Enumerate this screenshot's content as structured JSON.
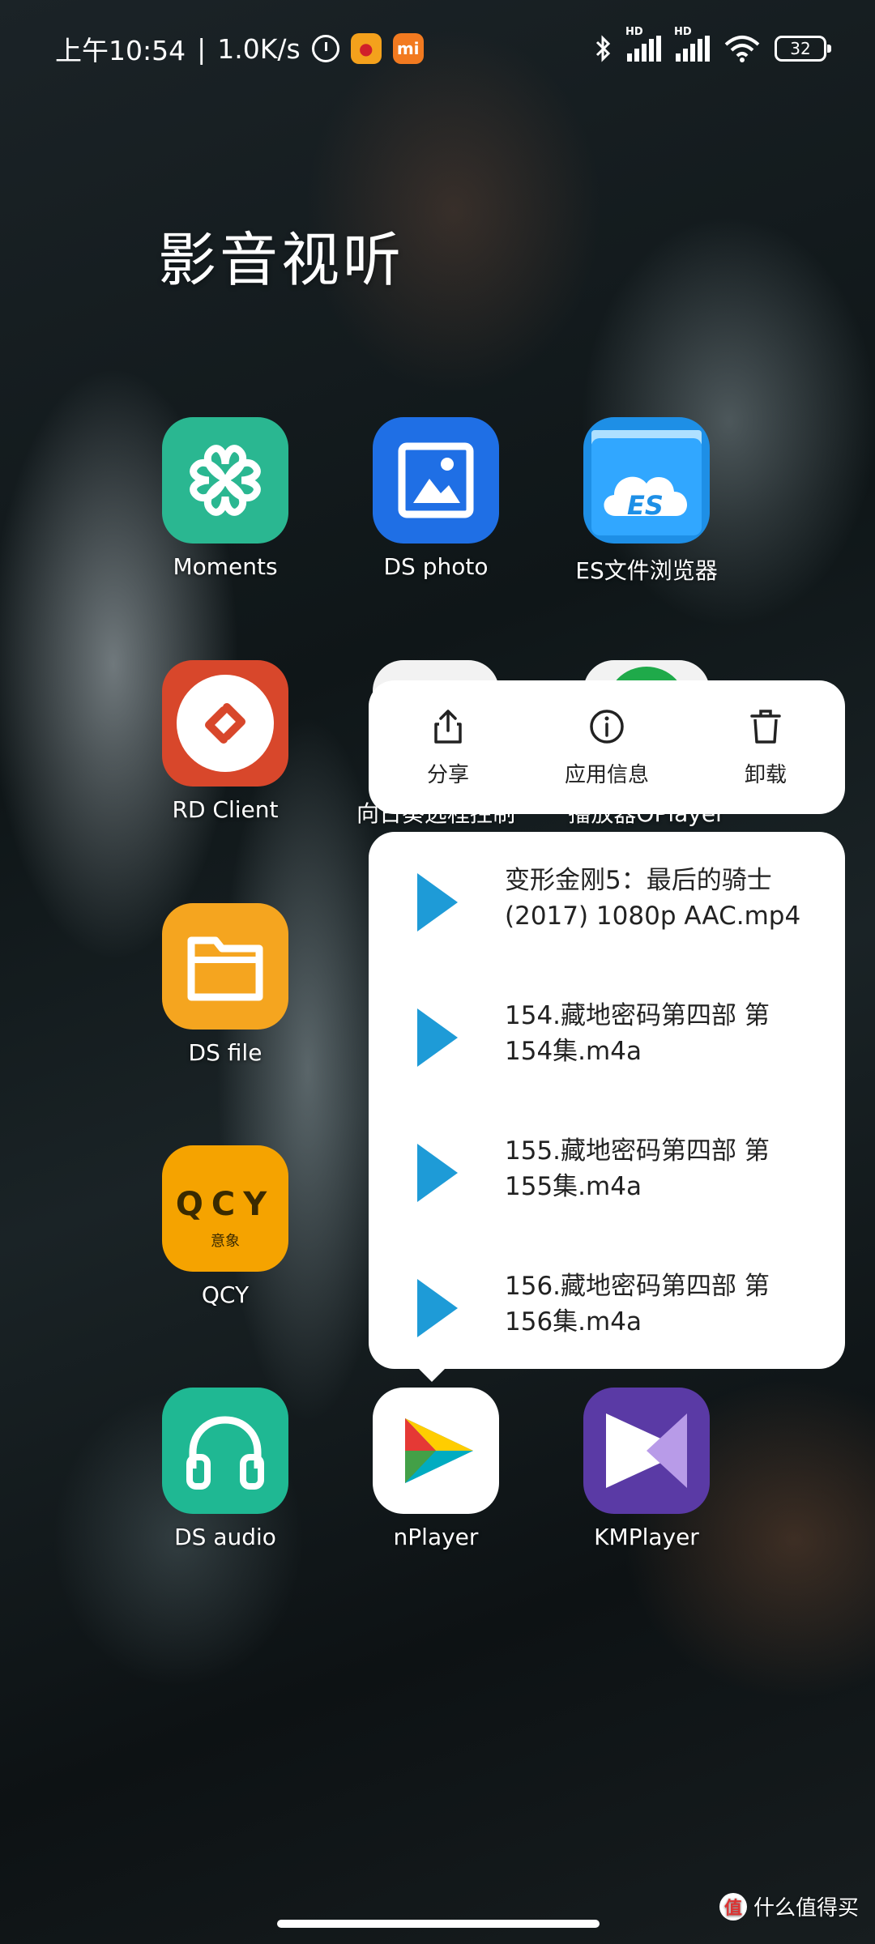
{
  "status_bar": {
    "time": "上午10:54",
    "separator": "|",
    "net_speed": "1.0K/s",
    "sim1_tag": "HD",
    "sim2_tag": "HD",
    "battery": "32",
    "icons": [
      "alarm-icon",
      "weibo-icon",
      "mi-icon",
      "bluetooth-icon",
      "signal-icon",
      "wifi-icon",
      "battery-icon"
    ]
  },
  "folder": {
    "title": "影音视听"
  },
  "apps": {
    "moments": "Moments",
    "ds_photo": "DS photo",
    "es_file": "ES文件浏览器",
    "rd_client": "RD Client",
    "remote": "向日葵远程控制",
    "player": "播放器OPlayer",
    "ds_file": "DS file",
    "qcy": "QCY",
    "ds_audio": "DS audio",
    "nplayer": "nPlayer",
    "kmplayer": "KMPlayer",
    "qcy_logo_text": "QCY",
    "qcy_sub_text": "意象",
    "es_logo_text": "ES"
  },
  "context_actions": {
    "share": "分享",
    "app_info": "应用信息",
    "uninstall": "卸载"
  },
  "recent_files": [
    {
      "line1": "变形金刚5：最后的骑士",
      "line2": "(2017) 1080p AAC.mp4"
    },
    {
      "line1": "154.藏地密码第四部 第",
      "line2": "154集.m4a"
    },
    {
      "line1": "155.藏地密码第四部 第",
      "line2": "155集.m4a"
    },
    {
      "line1": "156.藏地密码第四部 第",
      "line2": "156集.m4a"
    }
  ],
  "watermark": {
    "text": "什么值得买",
    "badge": "值"
  },
  "colors": {
    "moments": "#2ab791",
    "ds_photo": "#1f6fe5",
    "es_file": "#1e8fe6",
    "rd_client": "#d8472b",
    "ds_file": "#f5a51f",
    "qcy": "#f5a300",
    "ds_audio": "#1fb893",
    "nplayer": "#ffffff",
    "kmplayer": "#5a3aa5",
    "play_accent": "#1e9bd7"
  }
}
